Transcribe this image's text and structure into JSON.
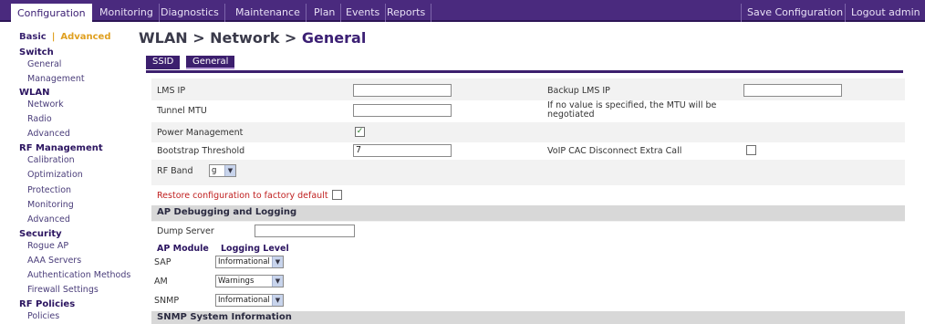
{
  "topnav": {
    "tabs": [
      "Configuration",
      "Monitoring",
      "Diagnostics",
      "Maintenance",
      "Plan",
      "Events",
      "Reports"
    ],
    "save": "Save Configuration",
    "logout": "Logout admin"
  },
  "sidebar": {
    "basic": "Basic",
    "advanced": "Advanced",
    "sections": [
      {
        "title": "Switch",
        "items": [
          "General",
          "Management"
        ]
      },
      {
        "title": "WLAN",
        "items": [
          "Network",
          "Radio",
          "Advanced"
        ]
      },
      {
        "title": "RF Management",
        "items": [
          "Calibration",
          "Optimization",
          "Protection",
          "Monitoring",
          "Advanced"
        ]
      },
      {
        "title": "Security",
        "items": [
          "Rogue AP",
          "AAA Servers",
          "Authentication Methods",
          "Firewall Settings"
        ]
      },
      {
        "title": "RF Policies",
        "items": [
          "Policies"
        ]
      }
    ]
  },
  "breadcrumb": {
    "path": "WLAN > Network > ",
    "current": "General"
  },
  "subtabs": [
    "SSID",
    "General"
  ],
  "form": {
    "lms_ip_label": "LMS IP",
    "lms_ip_value": "",
    "backup_lms_ip_label": "Backup LMS IP",
    "backup_lms_ip_value": "",
    "tunnel_mtu_label": "Tunnel MTU",
    "tunnel_mtu_value": "",
    "mtu_note": "If no value is specified, the MTU will be negotiated",
    "power_mgmt_label": "Power Management",
    "power_mgmt_checked": "✓",
    "bootstrap_label": "Bootstrap Threshold",
    "bootstrap_value": "7",
    "voip_label": "VoIP CAC Disconnect Extra Call",
    "rf_band_label": "RF Band",
    "rf_band_value": "g",
    "restore_label": "Restore configuration to factory default"
  },
  "ap_debug": {
    "title": "AP Debugging and Logging",
    "dump_server_label": "Dump Server",
    "dump_server_value": "",
    "col_module": "AP Module",
    "col_level": "Logging Level",
    "rows": [
      {
        "module": "SAP",
        "level": "Informational"
      },
      {
        "module": "AM",
        "level": "Warnings"
      },
      {
        "module": "SNMP",
        "level": "Informational"
      }
    ]
  },
  "snmp": {
    "title": "SNMP System Information"
  }
}
